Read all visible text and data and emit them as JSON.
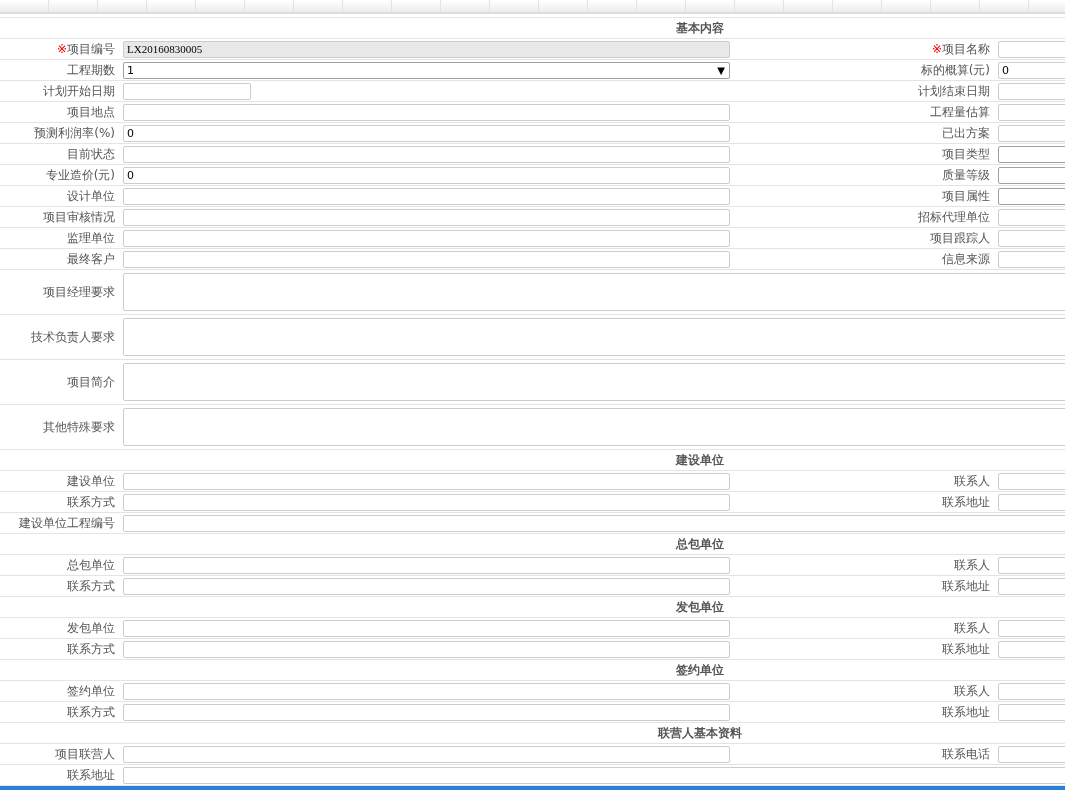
{
  "sections": [
    {
      "title": "基本内容",
      "rows": [
        {
          "kind": "pair",
          "left": {
            "mark": "※",
            "label": "项目编号",
            "field": {
              "kind": "readonly",
              "value": "LX20160830005"
            }
          },
          "right": {
            "mark": "※",
            "label": "项目名称",
            "field": {
              "kind": "text"
            }
          }
        },
        {
          "kind": "pair",
          "left": {
            "label": "工程期数",
            "field": {
              "kind": "select",
              "value": "1",
              "caret": "▼"
            }
          },
          "right": {
            "label": "标的概算(元)",
            "field": {
              "kind": "text",
              "value": "0"
            }
          }
        },
        {
          "kind": "pair",
          "left": {
            "label": "计划开始日期",
            "field": {
              "kind": "date"
            }
          },
          "right": {
            "label": "计划结束日期",
            "field": {
              "kind": "text"
            }
          }
        },
        {
          "kind": "pair",
          "left": {
            "label": "项目地点",
            "field": {
              "kind": "text"
            }
          },
          "right": {
            "label": "工程量估算",
            "field": {
              "kind": "text"
            }
          }
        },
        {
          "kind": "pair",
          "left": {
            "label": "预测利润率(%)",
            "field": {
              "kind": "text",
              "value": "0"
            }
          },
          "right": {
            "label": "已出方案",
            "field": {
              "kind": "text"
            }
          }
        },
        {
          "kind": "pair",
          "left": {
            "label": "目前状态",
            "field": {
              "kind": "text"
            }
          },
          "right": {
            "label": "项目类型",
            "field": {
              "kind": "select"
            }
          }
        },
        {
          "kind": "pair",
          "left": {
            "label": "专业造价(元)",
            "field": {
              "kind": "text",
              "value": "0"
            }
          },
          "right": {
            "label": "质量等级",
            "field": {
              "kind": "select"
            }
          }
        },
        {
          "kind": "pair",
          "left": {
            "label": "设计单位",
            "field": {
              "kind": "text"
            }
          },
          "right": {
            "label": "项目属性",
            "field": {
              "kind": "select"
            }
          }
        },
        {
          "kind": "pair",
          "left": {
            "label": "项目审核情况",
            "field": {
              "kind": "text"
            }
          },
          "right": {
            "label": "招标代理单位",
            "field": {
              "kind": "text"
            }
          }
        },
        {
          "kind": "pair",
          "left": {
            "label": "监理单位",
            "field": {
              "kind": "text"
            }
          },
          "right": {
            "label": "项目跟踪人",
            "field": {
              "kind": "text"
            }
          }
        },
        {
          "kind": "pair",
          "left": {
            "label": "最终客户",
            "field": {
              "kind": "text"
            }
          },
          "right": {
            "label": "信息来源",
            "field": {
              "kind": "text"
            }
          }
        },
        {
          "kind": "area",
          "label": "项目经理要求"
        },
        {
          "kind": "area",
          "label": "技术负责人要求"
        },
        {
          "kind": "area",
          "label": "项目简介"
        },
        {
          "kind": "area",
          "label": "其他特殊要求"
        }
      ]
    },
    {
      "title": "建设单位",
      "rows": [
        {
          "kind": "pair",
          "left": {
            "label": "建设单位",
            "field": {
              "kind": "text"
            }
          },
          "right": {
            "label": "联系人",
            "field": {
              "kind": "text"
            }
          }
        },
        {
          "kind": "pair",
          "left": {
            "label": "联系方式",
            "field": {
              "kind": "text"
            }
          },
          "right": {
            "label": "联系地址",
            "field": {
              "kind": "text"
            }
          }
        },
        {
          "kind": "wide",
          "label": "建设单位工程编号"
        }
      ]
    },
    {
      "title": "总包单位",
      "rows": [
        {
          "kind": "pair",
          "left": {
            "label": "总包单位",
            "field": {
              "kind": "text"
            }
          },
          "right": {
            "label": "联系人",
            "field": {
              "kind": "text"
            }
          }
        },
        {
          "kind": "pair",
          "left": {
            "label": "联系方式",
            "field": {
              "kind": "text"
            }
          },
          "right": {
            "label": "联系地址",
            "field": {
              "kind": "text"
            }
          }
        }
      ]
    },
    {
      "title": "发包单位",
      "rows": [
        {
          "kind": "pair",
          "left": {
            "label": "发包单位",
            "field": {
              "kind": "text"
            }
          },
          "right": {
            "label": "联系人",
            "field": {
              "kind": "text"
            }
          }
        },
        {
          "kind": "pair",
          "left": {
            "label": "联系方式",
            "field": {
              "kind": "text"
            }
          },
          "right": {
            "label": "联系地址",
            "field": {
              "kind": "text"
            }
          }
        }
      ]
    },
    {
      "title": "签约单位",
      "rows": [
        {
          "kind": "pair",
          "left": {
            "label": "签约单位",
            "field": {
              "kind": "text"
            }
          },
          "right": {
            "label": "联系人",
            "field": {
              "kind": "text"
            }
          }
        },
        {
          "kind": "pair",
          "left": {
            "label": "联系方式",
            "field": {
              "kind": "text"
            }
          },
          "right": {
            "label": "联系地址",
            "field": {
              "kind": "text"
            }
          }
        }
      ]
    },
    {
      "title": "联营人基本资料",
      "rows": [
        {
          "kind": "pair",
          "left": {
            "label": "项目联营人",
            "field": {
              "kind": "text"
            }
          },
          "right": {
            "label": "联系电话",
            "field": {
              "kind": "text"
            }
          }
        },
        {
          "kind": "wide",
          "label": "联系地址"
        }
      ]
    }
  ]
}
